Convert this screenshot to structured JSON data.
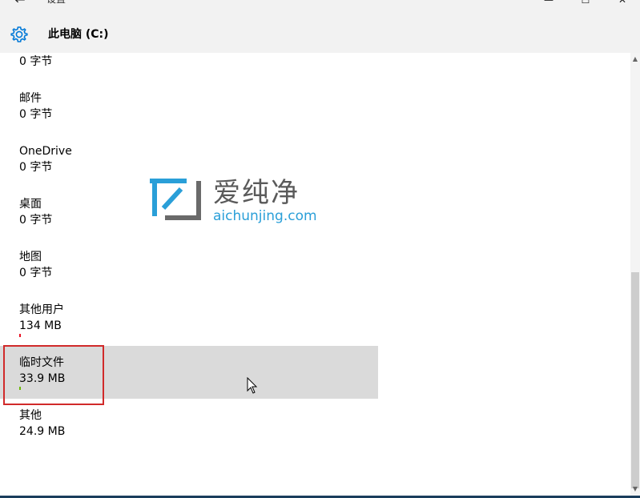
{
  "window": {
    "app_title": "设置",
    "back_glyph": "←",
    "minimize_glyph": "—",
    "maximize_glyph": "☐",
    "close_glyph": "✕"
  },
  "header": {
    "icon": "gear-icon",
    "title": "此电脑 (C:)"
  },
  "items": [
    {
      "name": "",
      "size": "0 字节"
    },
    {
      "name": "邮件",
      "size": "0 字节"
    },
    {
      "name": "OneDrive",
      "size": "0 字节"
    },
    {
      "name": "桌面",
      "size": "0 字节"
    },
    {
      "name": "地图",
      "size": "0 字节"
    },
    {
      "name": "其他用户",
      "size": "134 MB",
      "bar_color": "#e81123"
    },
    {
      "name": "临时文件",
      "size": "33.9 MB",
      "bar_color": "#6bb700",
      "highlighted": true
    },
    {
      "name": "其他",
      "size": "24.9 MB"
    }
  ],
  "watermark": {
    "cn": "爱纯净",
    "en": "aichunjing.com"
  },
  "colors": {
    "accent": "#0078d7",
    "highlight_bg": "#dadada",
    "annotation_box": "#d12a2a"
  }
}
